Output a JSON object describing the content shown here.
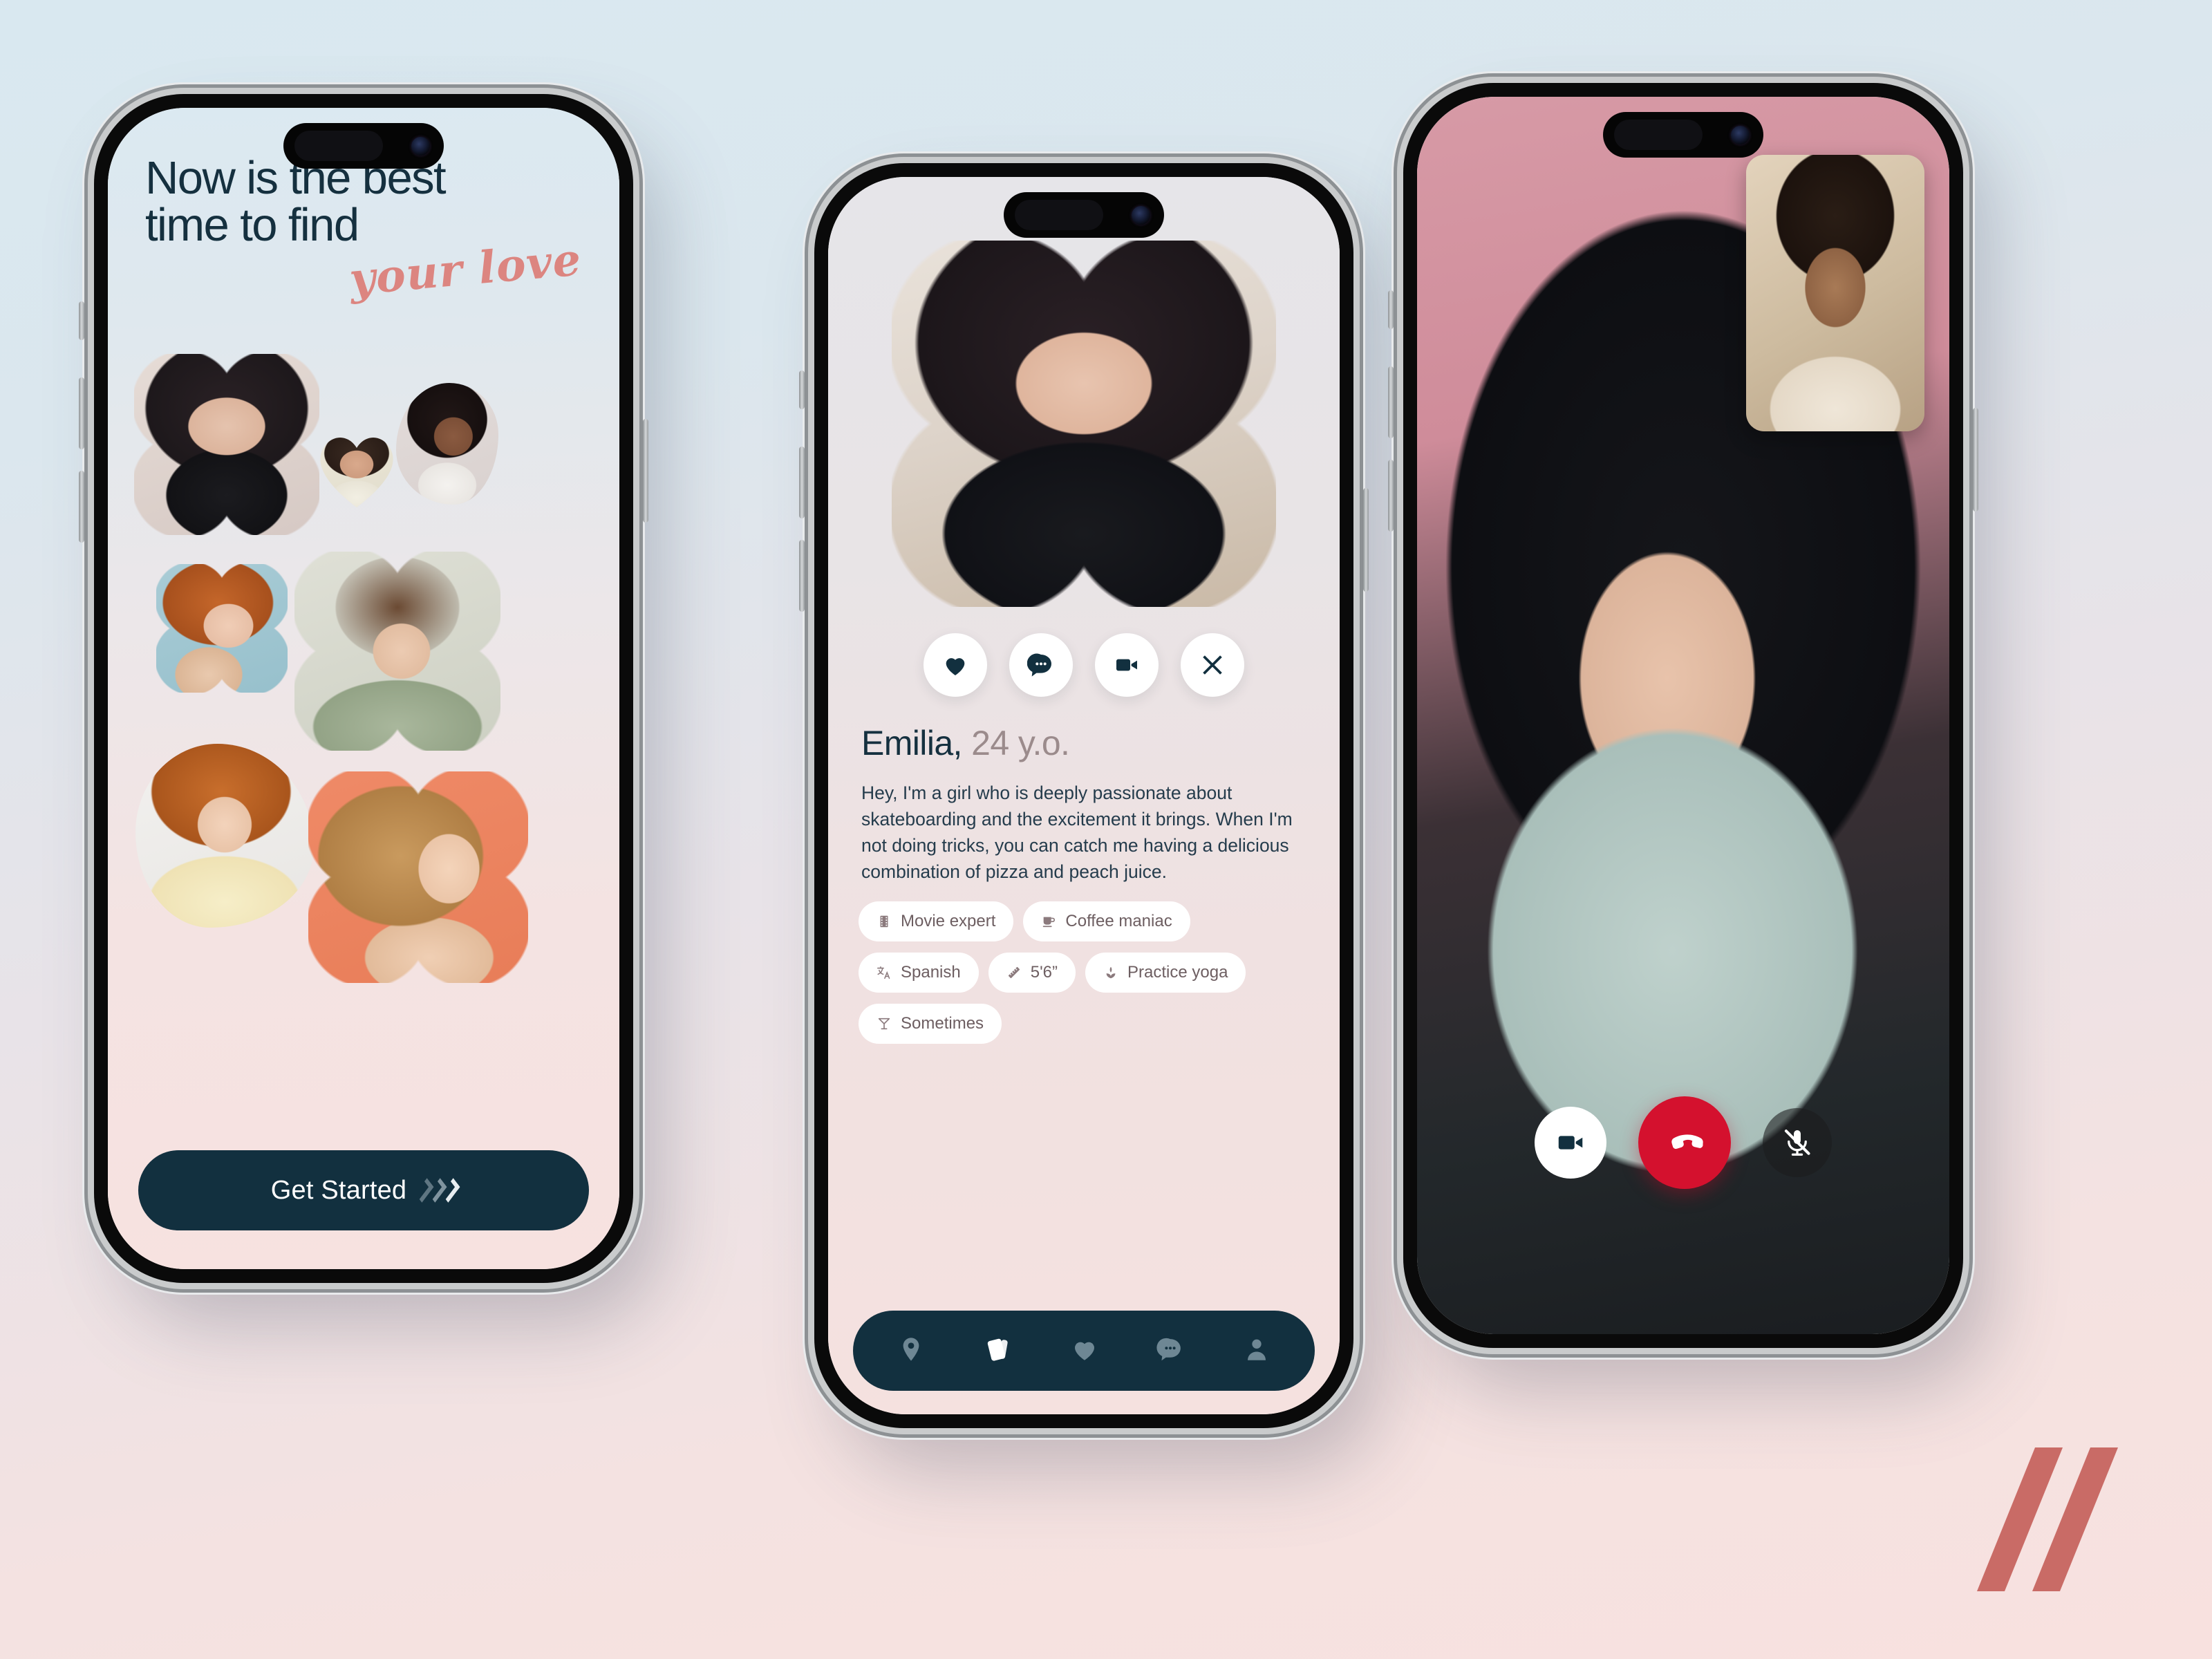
{
  "background": {
    "top_color": "#d9e8f0",
    "bottom_color": "#f7e1df"
  },
  "brand": {
    "logo_name": "double-slash-logo",
    "logo_color": "#c96b66"
  },
  "phones": {
    "onboarding": {
      "headline_line1": "Now is the best",
      "headline_line2": "time to find",
      "headline_script": "your love",
      "cta_label": "Get Started",
      "cta_icon": "triple-chevron-right-icon",
      "cta_bg": "#12303f",
      "photos": [
        {
          "name": "photo-woman-dark-hair-flower",
          "shape": "flower"
        },
        {
          "name": "photo-woman-bun-oval",
          "shape": "blob"
        },
        {
          "name": "photo-woman-smiling-heart",
          "shape": "heart"
        },
        {
          "name": "photo-woman-redhead-flower",
          "shape": "flower"
        },
        {
          "name": "photo-woman-green-sweater-flower",
          "shape": "flower"
        },
        {
          "name": "photo-woman-yellow-hoodie-blob",
          "shape": "blob"
        },
        {
          "name": "photo-woman-blonde-coral-flower",
          "shape": "flower"
        }
      ]
    },
    "profile": {
      "photo_name": "profile-photo-emilia",
      "name": "Emilia,",
      "age": "24 y.o.",
      "bio": "Hey, I'm a girl who is deeply passionate about skateboarding and the excitement it brings. When I'm not doing tricks, you can catch me having a delicious combination of pizza and peach juice.",
      "actions": [
        {
          "name": "like-button",
          "icon": "heart-icon"
        },
        {
          "name": "message-button",
          "icon": "chat-bubble-icon"
        },
        {
          "name": "video-call-button",
          "icon": "video-camera-icon"
        },
        {
          "name": "dismiss-button",
          "icon": "close-x-icon"
        }
      ],
      "chips": [
        {
          "label": "Movie expert",
          "icon": "film-strip-icon"
        },
        {
          "label": "Coffee maniac",
          "icon": "coffee-cup-icon"
        },
        {
          "label": "Spanish",
          "icon": "translate-icon"
        },
        {
          "label": "5'6”",
          "icon": "ruler-icon"
        },
        {
          "label": "Practice yoga",
          "icon": "lotus-icon"
        },
        {
          "label": "Sometimes",
          "icon": "cocktail-glass-icon"
        }
      ],
      "nav": [
        {
          "name": "nav-explore",
          "icon": "location-pin-icon",
          "active": false
        },
        {
          "name": "nav-cards",
          "icon": "cards-stack-icon",
          "active": true
        },
        {
          "name": "nav-likes",
          "icon": "heart-icon",
          "active": false
        },
        {
          "name": "nav-messages",
          "icon": "chat-bubble-icon",
          "active": false
        },
        {
          "name": "nav-profile",
          "icon": "person-icon",
          "active": false
        }
      ]
    },
    "video_call": {
      "main_video_name": "remote-video-woman",
      "pip_video_name": "self-video-man",
      "controls": [
        {
          "name": "toggle-camera-button",
          "icon": "video-camera-icon",
          "style": "white"
        },
        {
          "name": "end-call-button",
          "icon": "phone-hangup-icon",
          "style": "red",
          "color": "#d4112e"
        },
        {
          "name": "toggle-mic-button",
          "icon": "microphone-muted-icon",
          "style": "dark"
        }
      ]
    }
  }
}
